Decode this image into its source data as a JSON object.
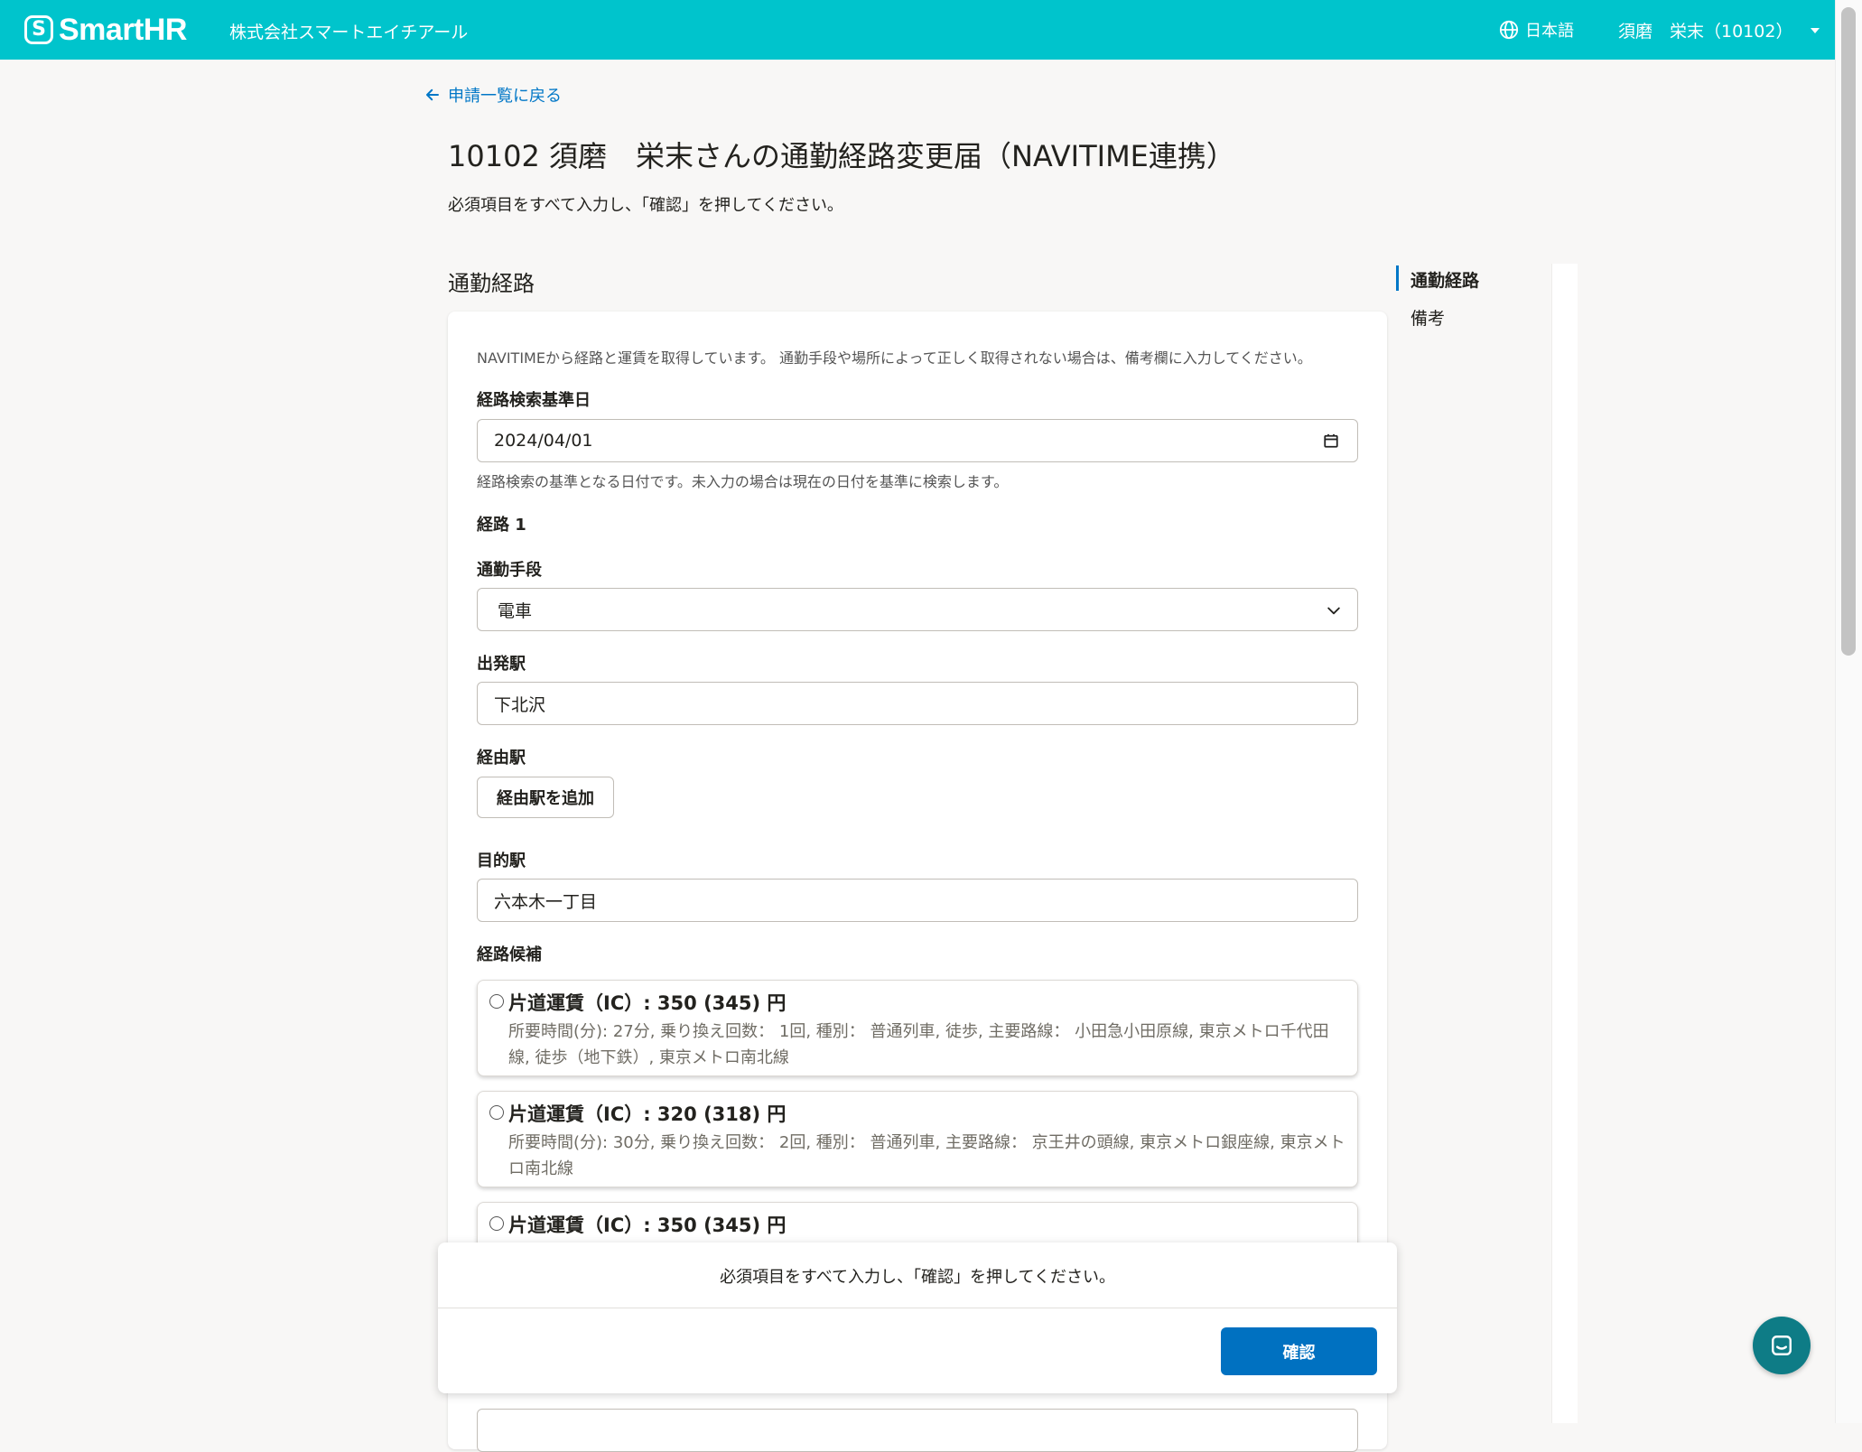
{
  "header": {
    "logo_text": "SmartHR",
    "tenant_name": "株式会社スマートエイチアール",
    "language": "日本語",
    "user": "須磨　栄末（10102）"
  },
  "nav": {
    "back_link": "申請一覧に戻る"
  },
  "page": {
    "title": "10102 須磨　栄末さんの通勤経路変更届（NAVITIME連携）",
    "description": "必須項目をすべて入力し、「確認」を押してください。",
    "section_title": "通勤経路"
  },
  "sidenav": {
    "items": [
      "通勤経路",
      "備考"
    ]
  },
  "form": {
    "note": "NAVITIMEから経路と運賃を取得しています。 通勤手段や場所によって正しく取得されない場合は、備考欄に入力してください。",
    "search_date_label": "経路検索基準日",
    "search_date_value": "2024/04/01",
    "search_date_help": "経路検索の基準となる日付です。未入力の場合は現在の日付を基準に検索します。",
    "route_heading": "経路 1",
    "transport_label": "通勤手段",
    "transport_value": "電車",
    "departure_label": "出発駅",
    "departure_value": "下北沢",
    "via_label": "経由駅",
    "via_add_button": "経由駅を追加",
    "destination_label": "目的駅",
    "destination_value": "六本木一丁目",
    "candidates_label": "経路候補",
    "candidates": [
      {
        "fare": "片道運賃（IC）: 350 (345) 円",
        "detail": "所要時間(分): 27分, 乗り換え回数： 1回, 種別： 普通列車, 徒歩, 主要路線： 小田急小田原線, 東京メトロ千代田線, 徒歩（地下鉄）, 東京メトロ南北線"
      },
      {
        "fare": "片道運賃（IC）: 320 (318) 円",
        "detail": "所要時間(分): 30分, 乗り換え回数： 2回, 種別： 普通列車, 主要路線： 京王井の頭線, 東京メトロ銀座線, 東京メトロ南北線"
      },
      {
        "fare": "片道運賃（IC）: 350 (345) 円",
        "detail": ""
      }
    ]
  },
  "footer": {
    "message": "必須項目をすべて入力し、「確認」を押してください。",
    "confirm_button": "確認"
  },
  "icons": {
    "globe": "globe-icon",
    "back": "arrow-left-icon",
    "calendar": "calendar-icon",
    "select": "chevron-down-icon",
    "chat": "chat-icon"
  },
  "colors": {
    "header_bg": "#00c4cc",
    "link": "#0077c7",
    "primary_button": "#0071c1",
    "chat_button": "#0e7c86"
  }
}
